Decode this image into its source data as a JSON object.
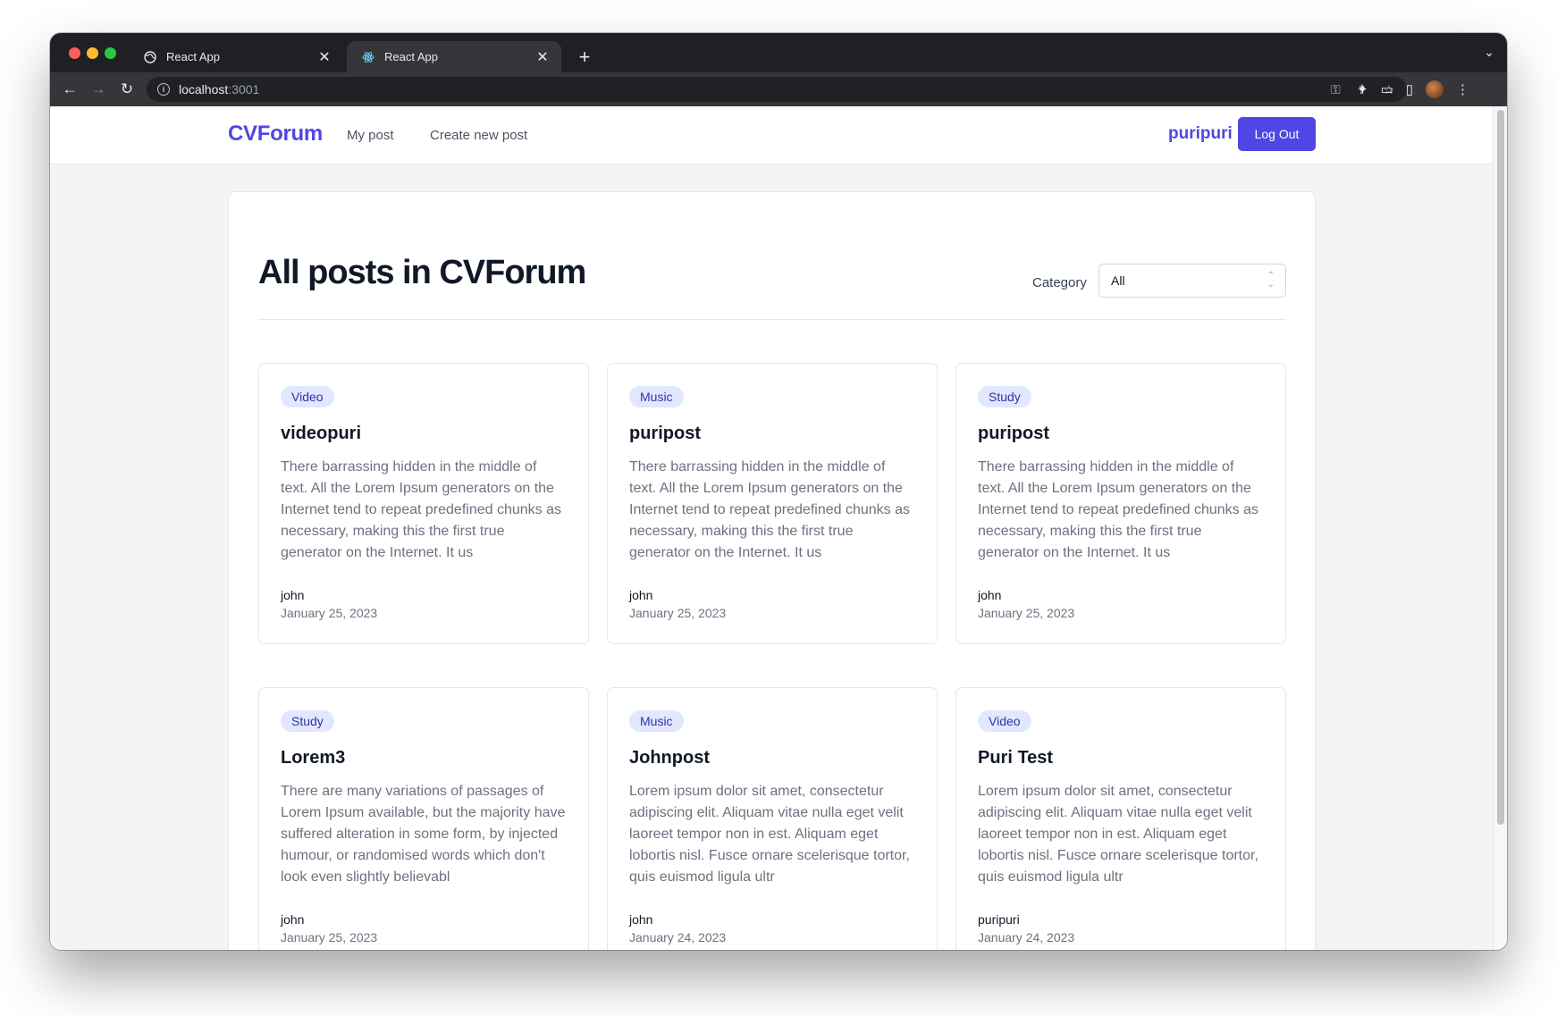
{
  "browser": {
    "tabs": [
      {
        "title": "React App",
        "active": false
      },
      {
        "title": "React App",
        "active": true
      }
    ],
    "url_host": "localhost",
    "url_port": ":3001"
  },
  "navbar": {
    "brand": "CVForum",
    "links": [
      "My post",
      "Create new post"
    ],
    "username": "puripuri",
    "logout_label": "Log Out"
  },
  "main": {
    "title": "All posts in CVForum",
    "category_label": "Category",
    "category_value": "All"
  },
  "posts": [
    {
      "category": "Video",
      "title": "videopuri",
      "excerpt": "There barrassing hidden in the middle of text. All the Lorem Ipsum generators on the Internet tend to repeat predefined chunks as necessary, making this the first true generator on the Internet. It us",
      "author": "john",
      "date": "January 25, 2023"
    },
    {
      "category": "Music",
      "title": "puripost",
      "excerpt": "There barrassing hidden in the middle of text. All the Lorem Ipsum generators on the Internet tend to repeat predefined chunks as necessary, making this the first true generator on the Internet. It us",
      "author": "john",
      "date": "January 25, 2023"
    },
    {
      "category": "Study",
      "title": "puripost",
      "excerpt": "There barrassing hidden in the middle of text. All the Lorem Ipsum generators on the Internet tend to repeat predefined chunks as necessary, making this the first true generator on the Internet. It us",
      "author": "john",
      "date": "January 25, 2023"
    },
    {
      "category": "Study",
      "title": "Lorem3",
      "excerpt": "There are many variations of passages of Lorem Ipsum available, but the majority have suffered alteration in some form, by injected humour, or randomised words which don't look even slightly believabl",
      "author": "john",
      "date": "January 25, 2023"
    },
    {
      "category": "Music",
      "title": "Johnpost",
      "excerpt": "Lorem ipsum dolor sit amet, consectetur adipiscing elit. Aliquam vitae nulla eget velit laoreet tempor non in est. Aliquam eget lobortis nisl. Fusce ornare scelerisque tortor, quis euismod ligula ultr",
      "author": "john",
      "date": "January 24, 2023"
    },
    {
      "category": "Video",
      "title": "Puri Test",
      "excerpt": "Lorem ipsum dolor sit amet, consectetur adipiscing elit. Aliquam vitae nulla eget velit laoreet tempor non in est. Aliquam eget lobortis nisl. Fusce ornare scelerisque tortor, quis euismod ligula ultr",
      "author": "puripuri",
      "date": "January 24, 2023"
    }
  ]
}
